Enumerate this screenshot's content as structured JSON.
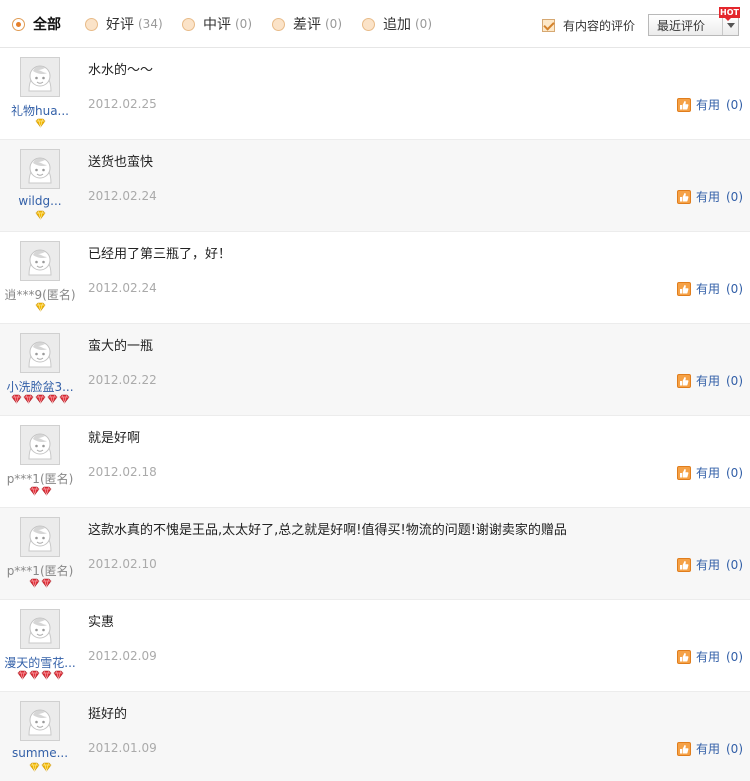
{
  "filter_bar": {
    "tabs": [
      {
        "label": "全部",
        "count": "",
        "active": true
      },
      {
        "label": "好评",
        "count": "(34)",
        "active": false
      },
      {
        "label": "中评",
        "count": "(0)",
        "active": false
      },
      {
        "label": "差评",
        "count": "(0)",
        "active": false
      },
      {
        "label": "追加",
        "count": "(0)",
        "active": false
      }
    ],
    "content_only_label": "有内容的评价",
    "content_only_checked": true,
    "sort_selected": "最近评价",
    "hot_badge": "HOT"
  },
  "colors": {
    "link_blue": "#3360a8",
    "gold_gem": "#f3b800",
    "red_gem": "#e0303a",
    "thumb_orange": "#f08a1c"
  },
  "reviews": [
    {
      "username": "礼物hua...",
      "anonymous": false,
      "badge_type": "gold-diamond",
      "badge_count": 1,
      "text": "水水的～～",
      "date": "2012.02.25",
      "useful_label": "有用",
      "useful_count": "(0)"
    },
    {
      "username": "wildg...",
      "anonymous": false,
      "badge_type": "gold-diamond",
      "badge_count": 1,
      "text": "送货也蛮快",
      "date": "2012.02.24",
      "useful_label": "有用",
      "useful_count": "(0)"
    },
    {
      "username": "逍***9(匿名)",
      "anonymous": true,
      "badge_type": "gold-diamond",
      "badge_count": 1,
      "text": "已经用了第三瓶了，好！",
      "date": "2012.02.24",
      "useful_label": "有用",
      "useful_count": "(0)"
    },
    {
      "username": "小洗脸盆3...",
      "anonymous": false,
      "badge_type": "red-heart",
      "badge_count": 5,
      "text": "蛮大的一瓶",
      "date": "2012.02.22",
      "useful_label": "有用",
      "useful_count": "(0)"
    },
    {
      "username": "p***1(匿名)",
      "anonymous": true,
      "badge_type": "red-heart",
      "badge_count": 2,
      "text": "就是好啊",
      "date": "2012.02.18",
      "useful_label": "有用",
      "useful_count": "(0)"
    },
    {
      "username": "p***1(匿名)",
      "anonymous": true,
      "badge_type": "red-heart",
      "badge_count": 2,
      "text": "这款水真的不愧是王品,太太好了,总之就是好啊!值得买!物流的问题!谢谢卖家的赠品",
      "date": "2012.02.10",
      "useful_label": "有用",
      "useful_count": "(0)"
    },
    {
      "username": "漫天的雪花...",
      "anonymous": false,
      "badge_type": "red-heart",
      "badge_count": 4,
      "text": "实惠",
      "date": "2012.02.09",
      "useful_label": "有用",
      "useful_count": "(0)"
    },
    {
      "username": "summe...",
      "anonymous": false,
      "badge_type": "gold-diamond",
      "badge_count": 2,
      "text": "挺好的",
      "date": "2012.01.09",
      "useful_label": "有用",
      "useful_count": "(0)"
    }
  ]
}
